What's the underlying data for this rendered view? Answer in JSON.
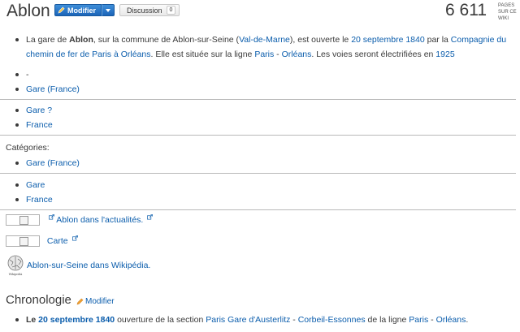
{
  "header": {
    "title": "Ablon",
    "edit_label": "Modifier",
    "talk_label": "Discussion",
    "talk_count": "0",
    "page_count": "6 611",
    "page_count_label": "PAGES SUR CE WIKI"
  },
  "intro": {
    "t1": "La gare de ",
    "b1": "Ablon",
    "t2": ", sur la commune de Ablon-sur-Seine (",
    "l1": "Val-de-Marne",
    "t3": "), est ouverte le ",
    "l2": "20 septembre 1840",
    "t4": " par la ",
    "l3": "Compagnie du chemin de fer de Paris à Orléans",
    "t5": ". Elle est située sur la ligne ",
    "l4": "Paris",
    "t6": " - ",
    "l5": "Orléans",
    "t7": ". Les voies seront électrifiées en ",
    "l6": "1925"
  },
  "list1": [
    "-",
    "Gare (France)"
  ],
  "list2": [
    "Gare ?",
    "France"
  ],
  "categories_label": "Catégories:",
  "list3": [
    "Gare (France)"
  ],
  "list4": [
    "Gare",
    "France"
  ],
  "links": {
    "news": "Ablon dans l'actualités.",
    "map": "Carte",
    "wikipedia": "Ablon-sur-Seine dans Wikipédia.",
    "wiki_logo_text": "WikipediA"
  },
  "chronology": {
    "heading": "Chronologie",
    "edit_label": "Modifier",
    "b1": "Le ",
    "l1": "20 septembre 1840",
    "t1": " ouverture de la section ",
    "l2": "Paris Gare d'Austerlitz",
    "t2": " - ",
    "l3": "Corbeil-Essonnes",
    "t3": " de la ligne ",
    "l4": "Paris",
    "t4": " - ",
    "l5": "Orléans",
    "t5": "."
  }
}
